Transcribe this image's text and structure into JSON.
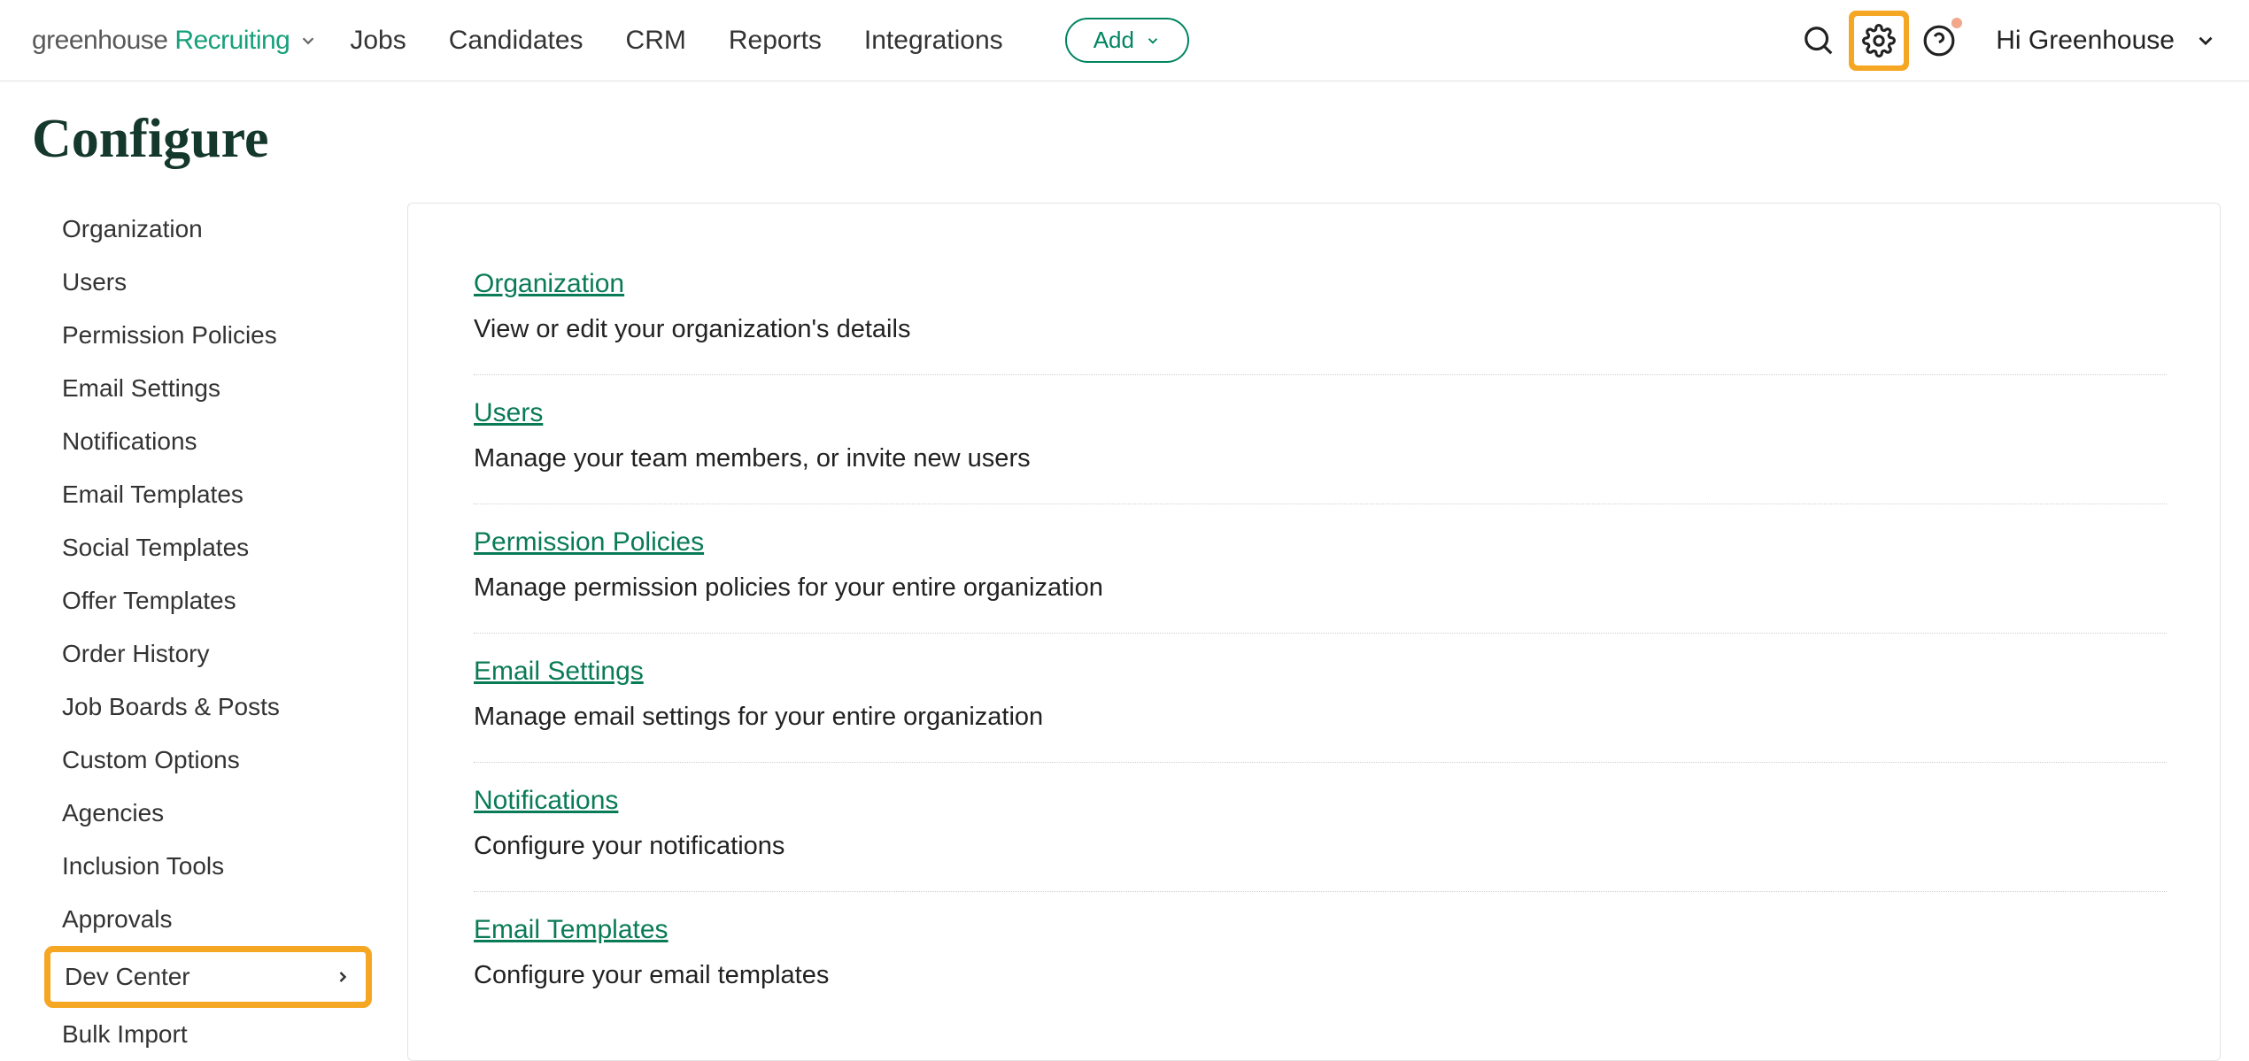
{
  "logo": {
    "part1": "greenhouse ",
    "part2": "Recruiting"
  },
  "nav": {
    "items": [
      "Jobs",
      "Candidates",
      "CRM",
      "Reports",
      "Integrations"
    ],
    "add_label": "Add",
    "user_greeting": "Hi Greenhouse"
  },
  "page_title": "Configure",
  "sidebar": {
    "items": [
      {
        "label": "Organization",
        "has_chevron": false,
        "highlight": false
      },
      {
        "label": "Users",
        "has_chevron": false,
        "highlight": false
      },
      {
        "label": "Permission Policies",
        "has_chevron": false,
        "highlight": false
      },
      {
        "label": "Email Settings",
        "has_chevron": false,
        "highlight": false
      },
      {
        "label": "Notifications",
        "has_chevron": false,
        "highlight": false
      },
      {
        "label": "Email Templates",
        "has_chevron": false,
        "highlight": false
      },
      {
        "label": "Social Templates",
        "has_chevron": false,
        "highlight": false
      },
      {
        "label": "Offer Templates",
        "has_chevron": false,
        "highlight": false
      },
      {
        "label": "Order History",
        "has_chevron": false,
        "highlight": false
      },
      {
        "label": "Job Boards & Posts",
        "has_chevron": false,
        "highlight": false
      },
      {
        "label": "Custom Options",
        "has_chevron": false,
        "highlight": false
      },
      {
        "label": "Agencies",
        "has_chevron": false,
        "highlight": false
      },
      {
        "label": "Inclusion Tools",
        "has_chevron": false,
        "highlight": false
      },
      {
        "label": "Approvals",
        "has_chevron": false,
        "highlight": false
      },
      {
        "label": "Dev Center",
        "has_chevron": true,
        "highlight": true
      },
      {
        "label": "Bulk Import",
        "has_chevron": false,
        "highlight": false
      }
    ]
  },
  "sections": [
    {
      "title": "Organization",
      "desc": "View or edit your organization's details"
    },
    {
      "title": "Users",
      "desc": "Manage your team members, or invite new users"
    },
    {
      "title": "Permission Policies",
      "desc": "Manage permission policies for your entire organization"
    },
    {
      "title": "Email Settings",
      "desc": "Manage email settings for your entire organization"
    },
    {
      "title": "Notifications",
      "desc": "Configure your notifications"
    },
    {
      "title": "Email Templates",
      "desc": "Configure your email templates"
    }
  ]
}
